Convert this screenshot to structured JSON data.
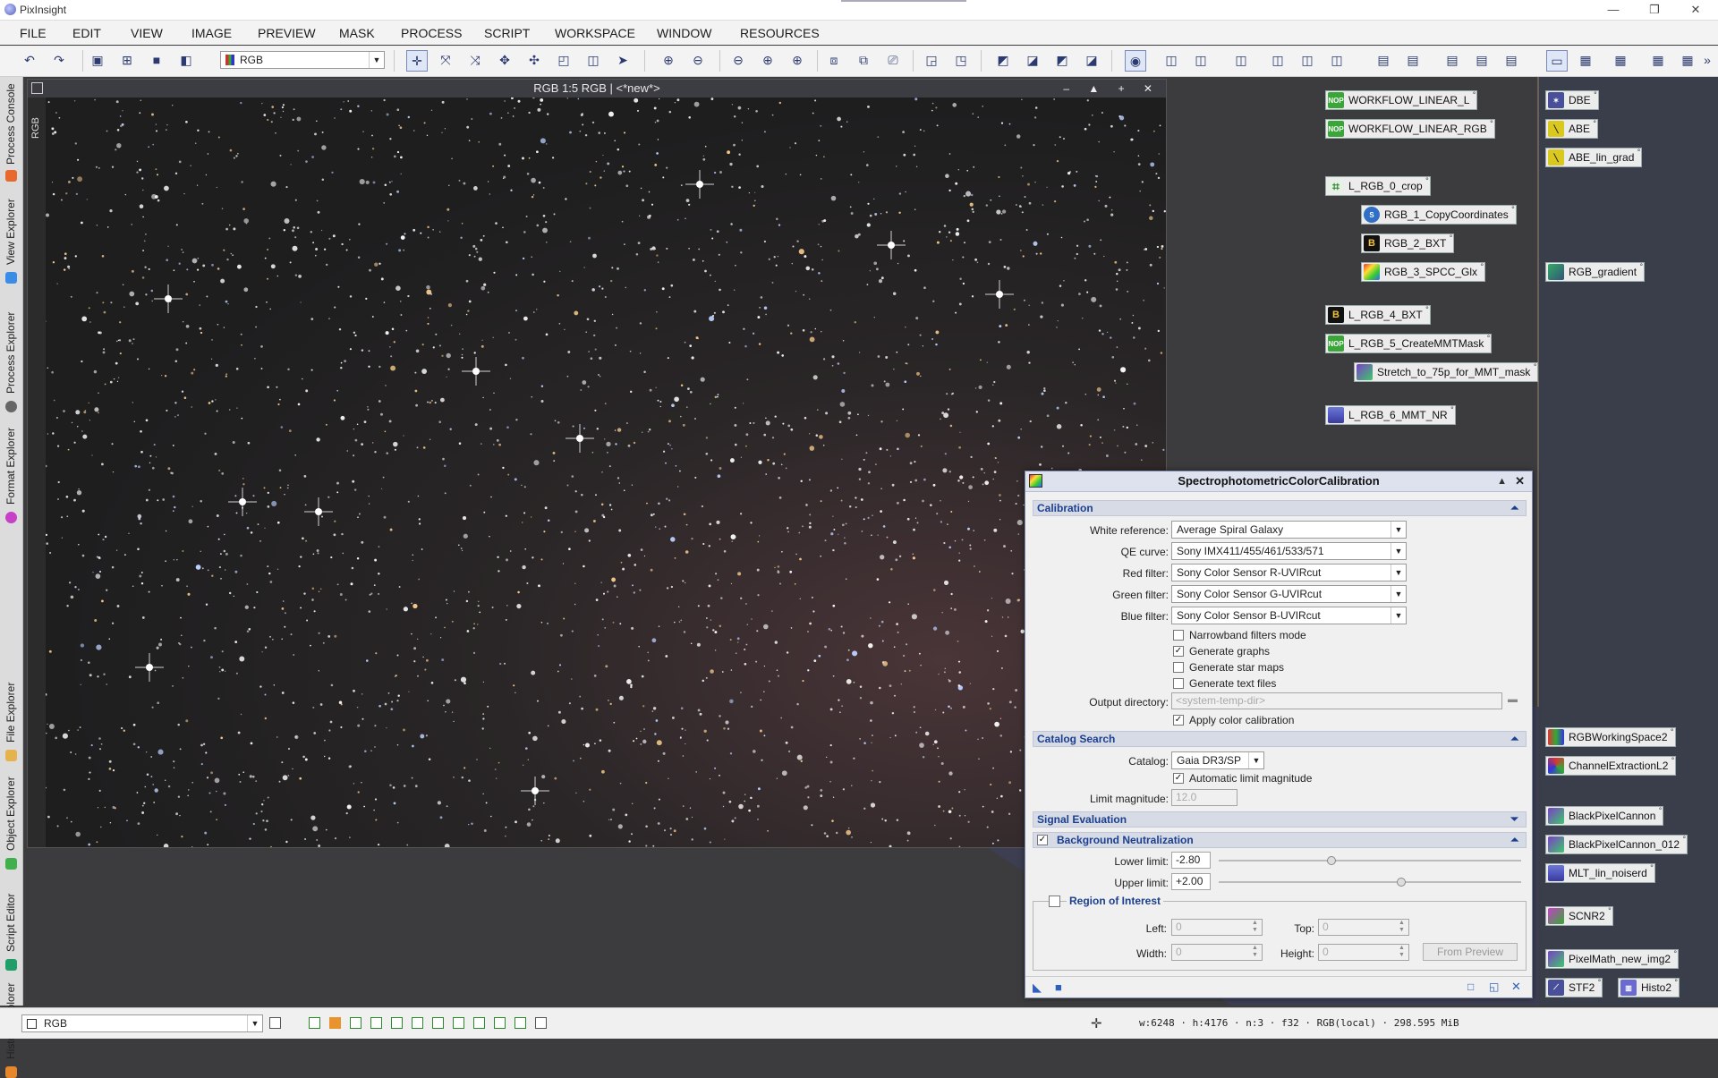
{
  "app": {
    "title": "PixInsight"
  },
  "window_controls": {
    "minimize": "—",
    "restore": "❐",
    "close": "✕"
  },
  "menu": [
    "FILE",
    "EDIT",
    "VIEW",
    "IMAGE",
    "PREVIEW",
    "MASK",
    "PROCESS",
    "SCRIPT",
    "WORKSPACE",
    "WINDOW",
    "RESOURCES"
  ],
  "toolbar": {
    "view_selector": "RGB"
  },
  "side_tabs": [
    "Process Console",
    "View Explorer",
    "Process Explorer",
    "Format Explorer",
    "File Explorer",
    "Object Explorer",
    "Script Editor",
    "History Explorer"
  ],
  "image_window": {
    "title": "RGB 1:5 RGB | <*new*>",
    "side_label": "RGB",
    "buttons": "– ▲ + ✕"
  },
  "process_icons_left": [
    "WORKFLOW_LINEAR_L",
    "WORKFLOW_LINEAR_RGB",
    "L_RGB_0_crop",
    "RGB_1_CopyCoordinates",
    "RGB_2_BXT",
    "RGB_3_SPCC_Glx",
    "L_RGB_4_BXT",
    "L_RGB_5_CreateMMTMask",
    "Stretch_to_75p_for_MMT_mask",
    "L_RGB_6_MMT_NR"
  ],
  "process_icons_right": [
    "DBE",
    "ABE",
    "ABE_lin_grad",
    "RGB_gradient",
    "RGBWorkingSpace2",
    "ChannelExtractionL2",
    "BlackPixelCannon",
    "BlackPixelCannon_012",
    "MLT_lin_noiserd",
    "SCNR2",
    "PixelMath_new_img2",
    "STF2",
    "Histo2"
  ],
  "icon_badges": {
    "nop": "NOP",
    "b": "B"
  },
  "dialog": {
    "title": "SpectrophotometricColorCalibration",
    "calibration": {
      "header": "Calibration",
      "white_reference_label": "White reference:",
      "white_reference": "Average Spiral Galaxy",
      "qe_curve_label": "QE curve:",
      "qe_curve": "Sony IMX411/455/461/533/571",
      "red_filter_label": "Red filter:",
      "red_filter": "Sony Color Sensor R-UVIRcut",
      "green_filter_label": "Green filter:",
      "green_filter": "Sony Color Sensor G-UVIRcut",
      "blue_filter_label": "Blue filter:",
      "blue_filter": "Sony Color Sensor B-UVIRcut",
      "narrowband": "Narrowband filters mode",
      "generate_graphs": "Generate graphs",
      "generate_star_maps": "Generate star maps",
      "generate_text_files": "Generate text files",
      "output_directory_label": "Output directory:",
      "output_directory_placeholder": "<system-temp-dir>",
      "apply_color_calibration": "Apply color calibration"
    },
    "catalog": {
      "header": "Catalog Search",
      "catalog_label": "Catalog:",
      "catalog": "Gaia DR3/SP",
      "auto_limit": "Automatic limit magnitude",
      "limit_label": "Limit magnitude:",
      "limit_value": "12.0"
    },
    "signal": {
      "header": "Signal Evaluation"
    },
    "background": {
      "header": "Background Neutralization",
      "lower_label": "Lower limit:",
      "lower_value": "-2.80",
      "lower_fraction": 0.37,
      "upper_label": "Upper limit:",
      "upper_value": "+2.00",
      "upper_fraction": 0.6
    },
    "roi": {
      "header": "Region of Interest",
      "left_label": "Left:",
      "left": "0",
      "top_label": "Top:",
      "top": "0",
      "width_label": "Width:",
      "width": "0",
      "height_label": "Height:",
      "height": "0",
      "from_preview": "From Preview"
    }
  },
  "statusbar": {
    "view": "RGB",
    "info": "w:6248 · h:4176 · n:3 · f32 · RGB(local) · 298.595 MiB"
  }
}
